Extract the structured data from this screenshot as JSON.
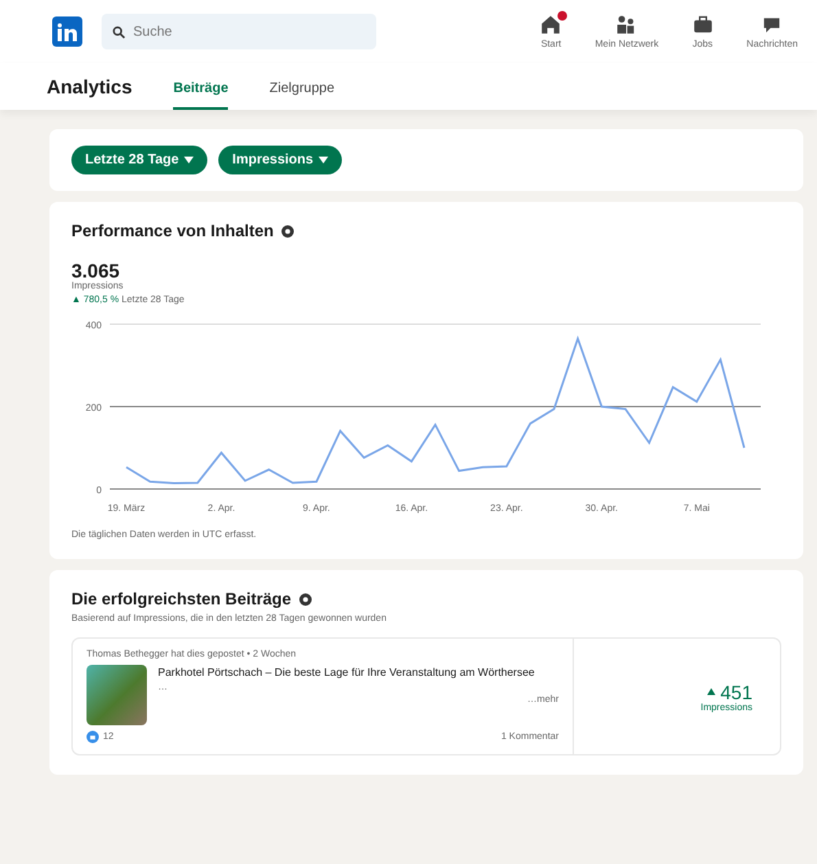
{
  "header": {
    "search": {
      "placeholder": "Suche"
    },
    "nav": [
      {
        "label": "Start",
        "badge": true
      },
      {
        "label": "Mein Netzwerk",
        "badge": false
      },
      {
        "label": "Jobs",
        "badge": false
      },
      {
        "label": "Nachrichten",
        "badge": false
      }
    ]
  },
  "subnav": {
    "title": "Analytics",
    "tabs": [
      {
        "label": "Beiträge",
        "selected": true
      },
      {
        "label": "Zielgruppe",
        "selected": false
      }
    ]
  },
  "filters": [
    "Letzte 28 Tage",
    "Impressions"
  ],
  "performance": {
    "title": "Performance von Inhalten",
    "total": "3.065",
    "metric": "Impressions",
    "change": "▲ 780,5 %",
    "period": "Letzte 28 Tage",
    "chart_data": {
      "type": "line",
      "categories": [
        "19. März",
        null,
        null,
        null,
        "2. Apr.",
        null,
        null,
        null,
        "9. Apr.",
        null,
        null,
        null,
        "16. Apr.",
        null,
        null,
        null,
        "23. Apr.",
        null,
        null,
        null,
        "30. Apr.",
        null,
        null,
        null,
        "7. Mai",
        null,
        null
      ],
      "series": [
        {
          "color": "#7aa6e8",
          "values": [
            53,
            18,
            14,
            15,
            88,
            20,
            47,
            15,
            18,
            141,
            76,
            106,
            67,
            156,
            44,
            53,
            55,
            159,
            194,
            365,
            200,
            194,
            112,
            247,
            212,
            314,
            100
          ]
        }
      ],
      "ylim": [
        0,
        400
      ],
      "yticks": [
        0,
        200,
        400
      ]
    },
    "footnote": "Die täglichen Daten werden in UTC erfasst."
  },
  "top_posts": {
    "title": "Die erfolgreichsten Beiträge",
    "subtitle": "Basierend auf Impressions, die in den letzten 28 Tagen gewonnen wurden",
    "posts": [
      {
        "author_line": "Thomas Bethegger hat dies gepostet • 2 Wochen",
        "text": "Parkhotel Pörtschach – Die beste Lage für Ihre Veranstaltung am Wörthersee",
        "ellipsis": "…",
        "more": "…mehr",
        "reactions": "12",
        "comments": "1 Kommentar",
        "value": "451",
        "metric": "Impressions"
      }
    ]
  }
}
